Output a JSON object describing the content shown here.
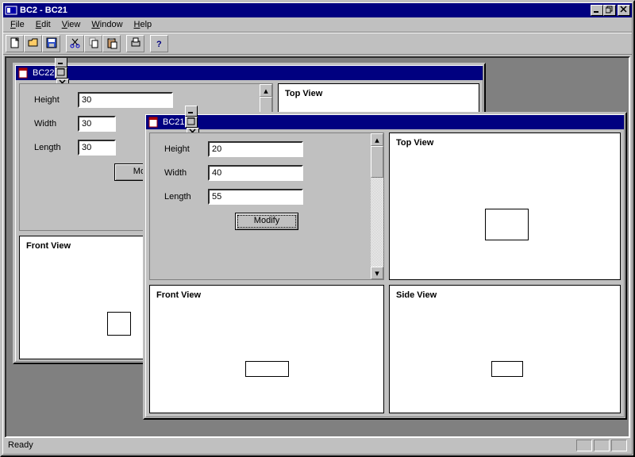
{
  "app_title": "BC2 - BC21",
  "menu": {
    "file": "File",
    "edit": "Edit",
    "view": "View",
    "window": "Window",
    "help": "Help"
  },
  "status": {
    "text": "Ready"
  },
  "win_bc22": {
    "title": "BC22",
    "form": {
      "height_label": "Height",
      "height_value": "30",
      "width_label": "Width",
      "width_value": "30",
      "length_label": "Length",
      "length_value": "30",
      "modify": "Modify"
    },
    "views": {
      "top": "Top View",
      "front": "Front View"
    }
  },
  "win_bc21": {
    "title": "BC21",
    "form": {
      "height_label": "Height",
      "height_value": "20",
      "width_label": "Width",
      "width_value": "40",
      "length_label": "Length",
      "length_value": "55",
      "modify": "Modify"
    },
    "views": {
      "top": "Top View",
      "front": "Front View",
      "side": "Side View"
    }
  }
}
